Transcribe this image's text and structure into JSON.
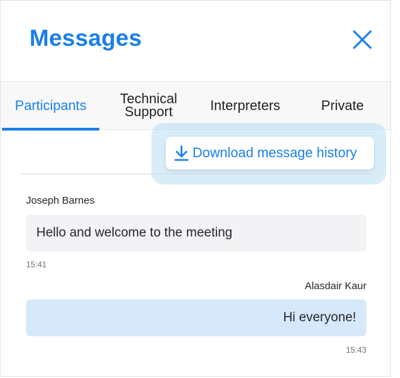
{
  "header": {
    "title": "Messages"
  },
  "tabs": [
    {
      "label": "Participants",
      "active": true
    },
    {
      "label": "Technical\nSupport",
      "active": false
    },
    {
      "label": "Interpreters",
      "active": false
    },
    {
      "label": "Private",
      "active": false
    }
  ],
  "download": {
    "label": "Download message history",
    "icon": "download-icon"
  },
  "messages": [
    {
      "sender": "Joseph Barnes",
      "text": "Hello and welcome to the meeting",
      "time": "15:41",
      "direction": "incoming"
    },
    {
      "sender": "Alasdair Kaur",
      "text": "Hi everyone!",
      "time": "15:43",
      "direction": "outgoing"
    }
  ],
  "colors": {
    "accent": "#1a7fe8",
    "incoming_bubble": "#f3f3f5",
    "outgoing_bubble": "#d7e8fb",
    "highlight": "#a8d8ee"
  }
}
